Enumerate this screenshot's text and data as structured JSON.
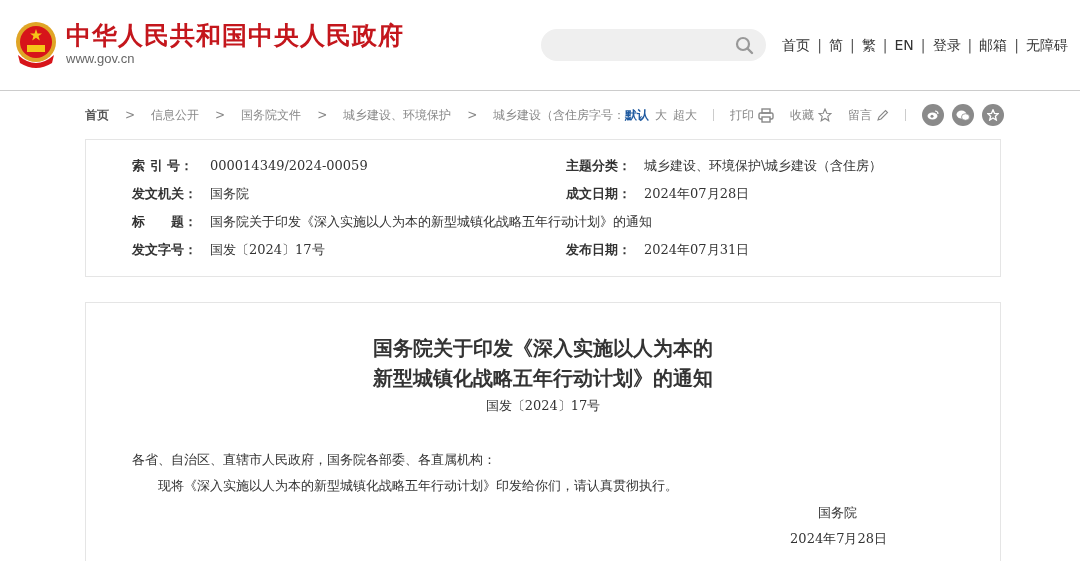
{
  "header": {
    "site_title": "中华人民共和国中央人民政府",
    "domain": "www.gov.cn",
    "top_links": [
      "首页",
      "简",
      "繁",
      "EN",
      "登录",
      "邮箱",
      "无障碍"
    ],
    "link_separator": "|"
  },
  "breadcrumb": {
    "separator": ">",
    "items": [
      "首页",
      "信息公开",
      "国务院文件",
      "城乡建设、环境保护",
      "城乡建设（含住房"
    ]
  },
  "font_size": {
    "label": "字号：",
    "options": [
      {
        "label": "默认",
        "selected": true
      },
      {
        "label": "大",
        "selected": false
      },
      {
        "label": "超大",
        "selected": false
      }
    ]
  },
  "tools": [
    {
      "label": "打印",
      "kind": "print"
    },
    {
      "label": "收藏",
      "kind": "star"
    },
    {
      "label": "留言",
      "kind": "pencil"
    }
  ],
  "share": [
    {
      "kind": "weibo"
    },
    {
      "kind": "wechat"
    },
    {
      "kind": "favorite"
    }
  ],
  "meta": [
    {
      "label": "索 引 号：",
      "value": "000014349/2024-00059"
    },
    {
      "label": "主题分类：",
      "value": "城乡建设、环境保护\\城乡建设（含住房）"
    },
    {
      "label": "发文机关：",
      "value": "国务院"
    },
    {
      "label": "成文日期：",
      "value": "2024年07月28日"
    },
    {
      "label": "标　　题：",
      "value": "国务院关于印发《深入实施以人为本的新型城镇化战略五年行动计划》的通知",
      "wide": true
    },
    {
      "label": "发文字号：",
      "value": "国发〔2024〕17号"
    },
    {
      "label": "发布日期：",
      "value": "2024年07月31日"
    }
  ],
  "article": {
    "title_lines": [
      "国务院关于印发《深入实施以人为本的",
      "新型城镇化战略五年行动计划》的通知"
    ],
    "doc_number": "国发〔2024〕17号",
    "salutation": "各省、自治区、直辖市人民政府，国务院各部委、各直属机构：",
    "paragraphs": [
      "现将《深入实施以人为本的新型城镇化战略五年行动计划》印发给你们，请认真贯彻执行。"
    ],
    "signature": "国务院",
    "date": "2024年7月28日"
  }
}
